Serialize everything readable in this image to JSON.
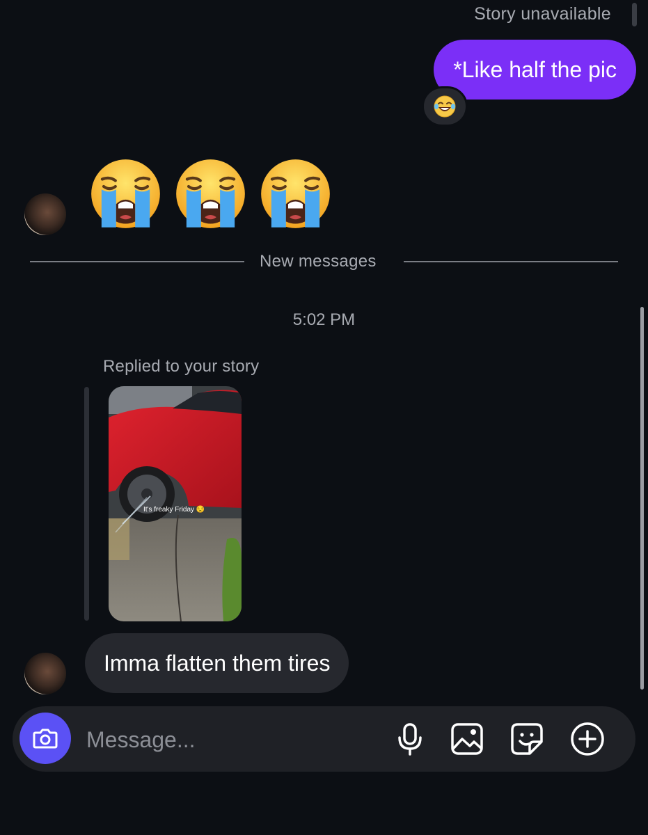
{
  "thread": {
    "story_status": "Story unavailable",
    "outgoing_message": "*Like half the pic",
    "reaction_emoji": "😂",
    "incoming_emojis": [
      "😭",
      "😭",
      "😭"
    ],
    "divider_label": "New messages",
    "timestamp": "5:02 PM",
    "reply_context": "Replied to your story",
    "story_caption": "It's freaky Friday 😒",
    "incoming_message": "Imma flatten them tires"
  },
  "composer": {
    "placeholder": "Message...",
    "icons": [
      "camera-icon",
      "microphone-icon",
      "gallery-icon",
      "sticker-icon",
      "plus-icon"
    ]
  },
  "colors": {
    "background": "#0c0f14",
    "outgoing_bubble": "#7b2ff7",
    "incoming_bubble": "#26282e",
    "camera_button": "#5b51f5",
    "secondary_text": "#a8abb2"
  }
}
